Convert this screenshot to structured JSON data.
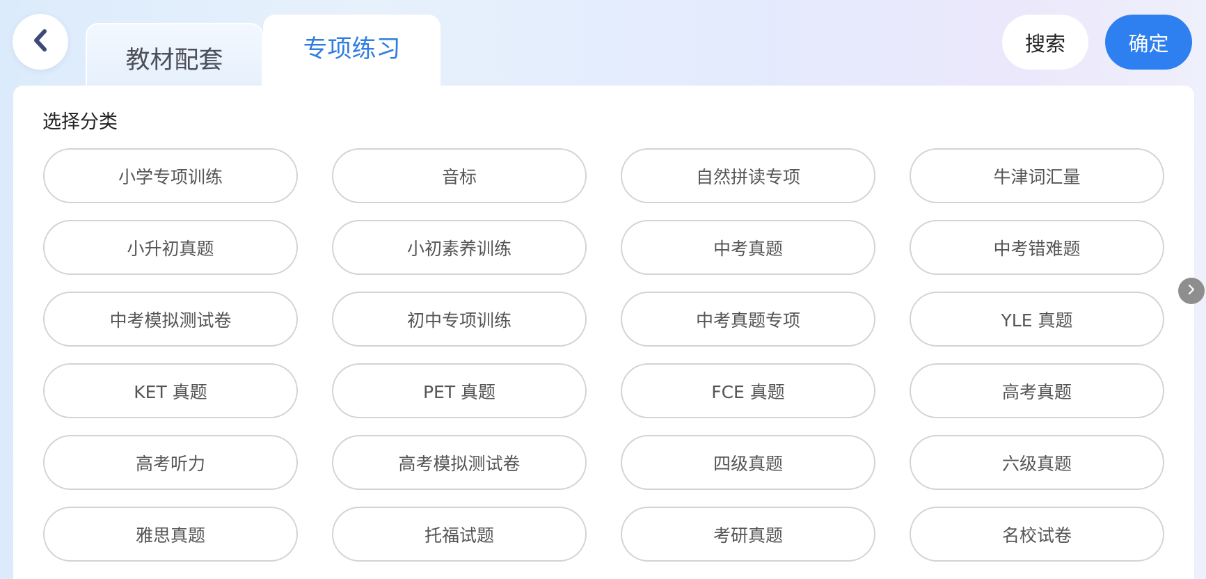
{
  "header": {
    "back_icon": "chevron-left-icon",
    "tabs": [
      {
        "label": "教材配套",
        "active": false
      },
      {
        "label": "专项练习",
        "active": true
      }
    ],
    "search_label": "搜索",
    "confirm_label": "确定"
  },
  "panel": {
    "section_title": "选择分类",
    "categories": [
      "小学专项训练",
      "音标",
      "自然拼读专项",
      "牛津词汇量",
      "小升初真题",
      "小初素养训练",
      "中考真题",
      "中考错难题",
      "中考模拟测试卷",
      "初中专项训练",
      "中考真题专项",
      "YLE 真题",
      "KET 真题",
      "PET 真题",
      "FCE 真题",
      "高考真题",
      "高考听力",
      "高考模拟测试卷",
      "四级真题",
      "六级真题",
      "雅思真题",
      "托福试题",
      "考研真题",
      "名校试卷"
    ],
    "next_icon": "chevron-right-icon"
  },
  "colors": {
    "accent": "#2e7ff0",
    "active_tab_text": "#2f7de1",
    "pill_border": "#d3d3d3"
  }
}
